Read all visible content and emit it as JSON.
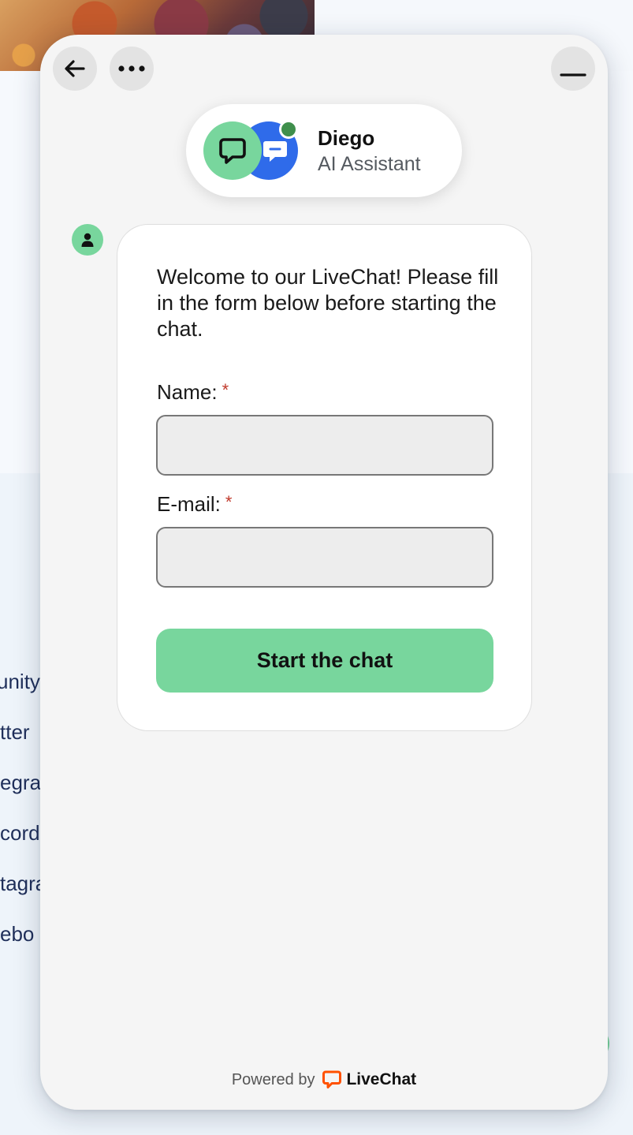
{
  "background": {
    "links": [
      "unity",
      "tter",
      "egra",
      "cord",
      "tagra",
      "ebo"
    ]
  },
  "widget": {
    "header": {
      "back_icon": "arrow-left-icon",
      "more_icon": "ellipsis-icon",
      "minimize_icon": "minimize-icon"
    },
    "agent": {
      "name": "Diego",
      "role": "AI Assistant",
      "status": "online"
    },
    "message": {
      "welcome": "Welcome to our LiveChat! Please fill in the form below before starting the chat."
    },
    "form": {
      "name_label": "Name:",
      "email_label": "E-mail:",
      "required_mark": "*",
      "name_value": "",
      "email_value": "",
      "submit_label": "Start the chat"
    },
    "footer": {
      "powered_by": "Powered by",
      "brand": "LiveChat"
    }
  },
  "colors": {
    "accent_green": "#78d69d",
    "brand_blue": "#2f6bea",
    "online": "#3f8f4c",
    "required": "#c0392b",
    "brand_orange": "#ff5100"
  }
}
